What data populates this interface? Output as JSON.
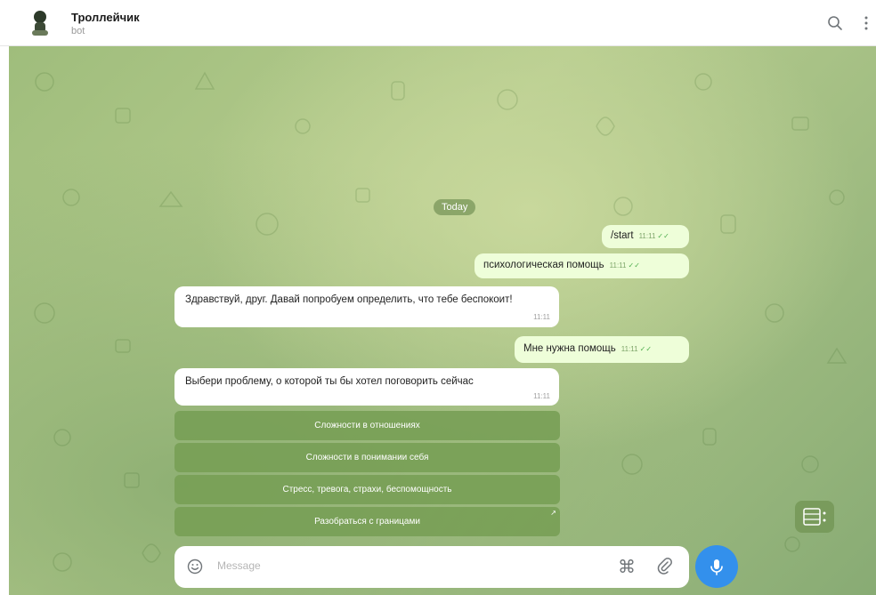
{
  "header": {
    "title": "Троллейчик",
    "subtitle": "bot",
    "search_icon": "search-icon",
    "more_icon": "more-vertical-icon"
  },
  "chat": {
    "date_chip": "Today",
    "messages": [
      {
        "direction": "out",
        "text": "/start",
        "time": "11:11"
      },
      {
        "direction": "out",
        "text": "психологическая помощь",
        "time": "11:11"
      },
      {
        "direction": "in",
        "text": "Здравствуй, друг. Давай попробуем определить, что тебе беспокоит!",
        "time": "11:11"
      },
      {
        "direction": "out",
        "text": "Мне нужна помощь",
        "time": "11:11"
      },
      {
        "direction": "in",
        "text": "Выбери проблему, о которой ты бы хотел поговорить сейчас",
        "time": "11:11"
      }
    ],
    "keyboard_buttons": [
      "Сложности в отношениях",
      "Сложности в понимании себя",
      "Стресс, тревога, страхи, беспомощность",
      "Разобраться с границами"
    ]
  },
  "composer": {
    "placeholder": "Message",
    "emoji_icon": "emoji-icon",
    "command_icon": "command-icon",
    "command_glyph": "⌘",
    "attach_icon": "paperclip-icon",
    "mic_icon": "microphone-icon"
  },
  "colors": {
    "accent": "#3390ec",
    "outgoing_bubble": "#eefed9",
    "incoming_bubble": "#ffffff",
    "keyboard_button": "#769e54"
  }
}
